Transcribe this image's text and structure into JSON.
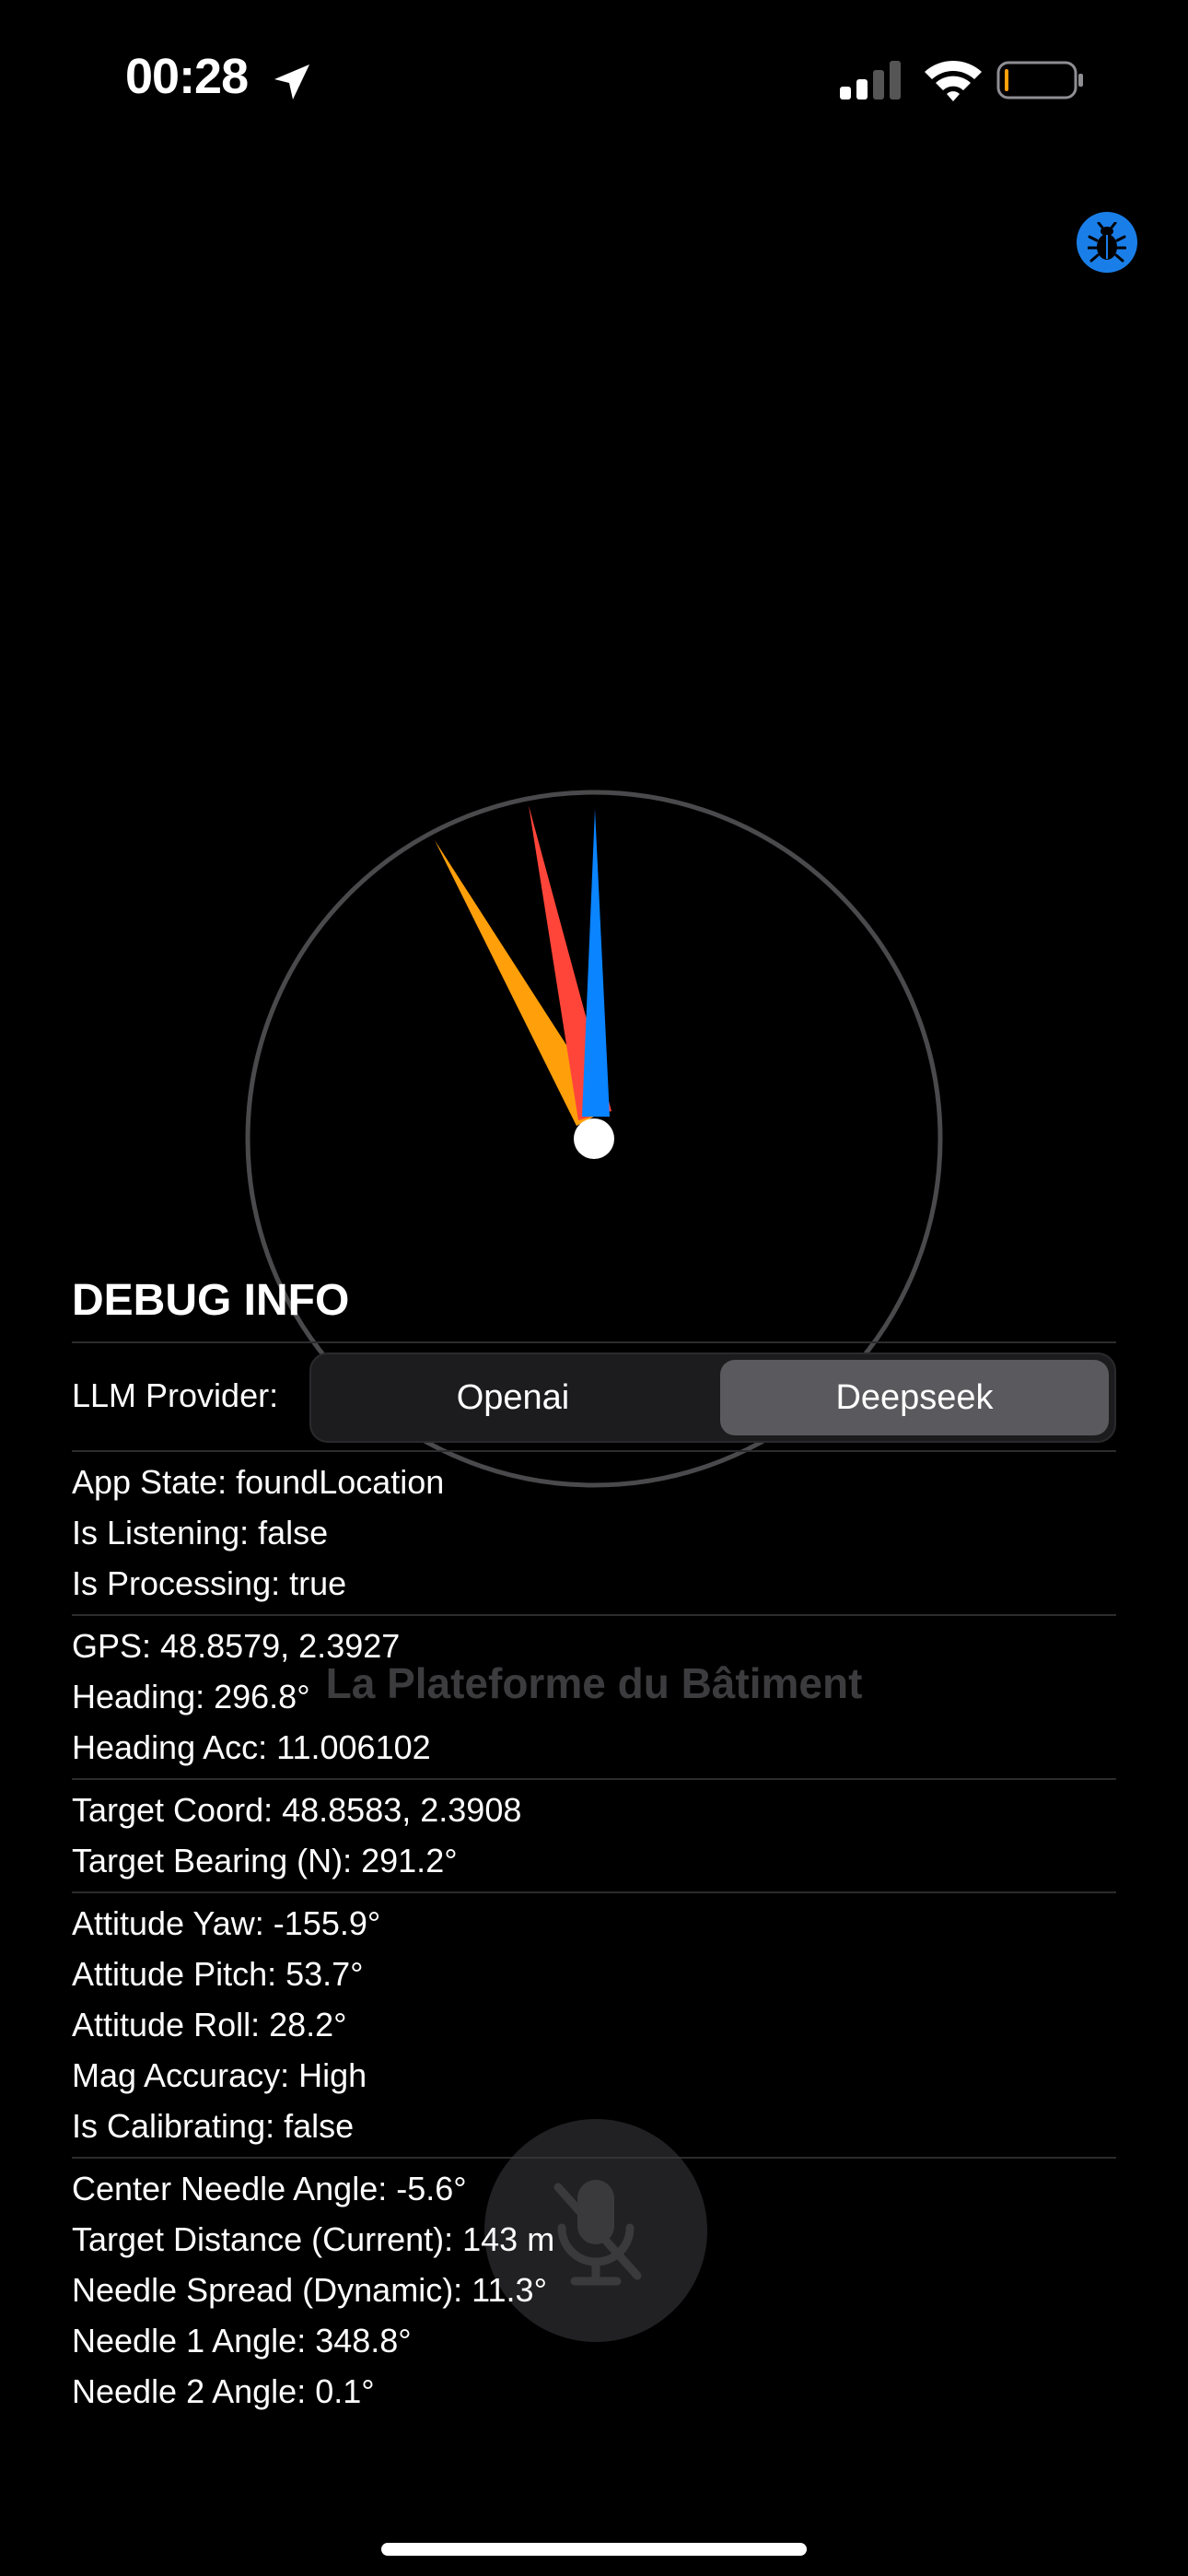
{
  "status_bar": {
    "time": "00:28"
  },
  "place_name": "La Plateforme du Bâtiment",
  "debug": {
    "title": "DEBUG INFO",
    "llm_label": "LLM Provider:",
    "providers": [
      "Openai",
      "Deepseek"
    ],
    "selected_provider": "Deepseek",
    "group1": [
      "App State: foundLocation",
      "Is Listening: false",
      "Is Processing: true"
    ],
    "group2": [
      "GPS: 48.8579, 2.3927",
      "Heading: 296.8°",
      "Heading Acc: 11.006102"
    ],
    "group3": [
      "Target Coord: 48.8583, 2.3908",
      "Target Bearing (N): 291.2°"
    ],
    "group4": [
      "Attitude Yaw: -155.9°",
      "Attitude Pitch: 53.7°",
      "Attitude Roll: 28.2°",
      "Mag Accuracy: High",
      "Is Calibrating: false"
    ],
    "group5": [
      "Center Needle Angle: -5.6°",
      "Target Distance (Current): 143 m",
      "Needle Spread (Dynamic): 11.3°",
      "Needle 1 Angle: 348.8°",
      "Needle 2 Angle: 0.1°"
    ]
  },
  "colors": {
    "accent": "#1a7ee8",
    "needle_orange": "#ff9f0a",
    "needle_red": "#ff453a",
    "needle_blue": "#0a84ff"
  }
}
